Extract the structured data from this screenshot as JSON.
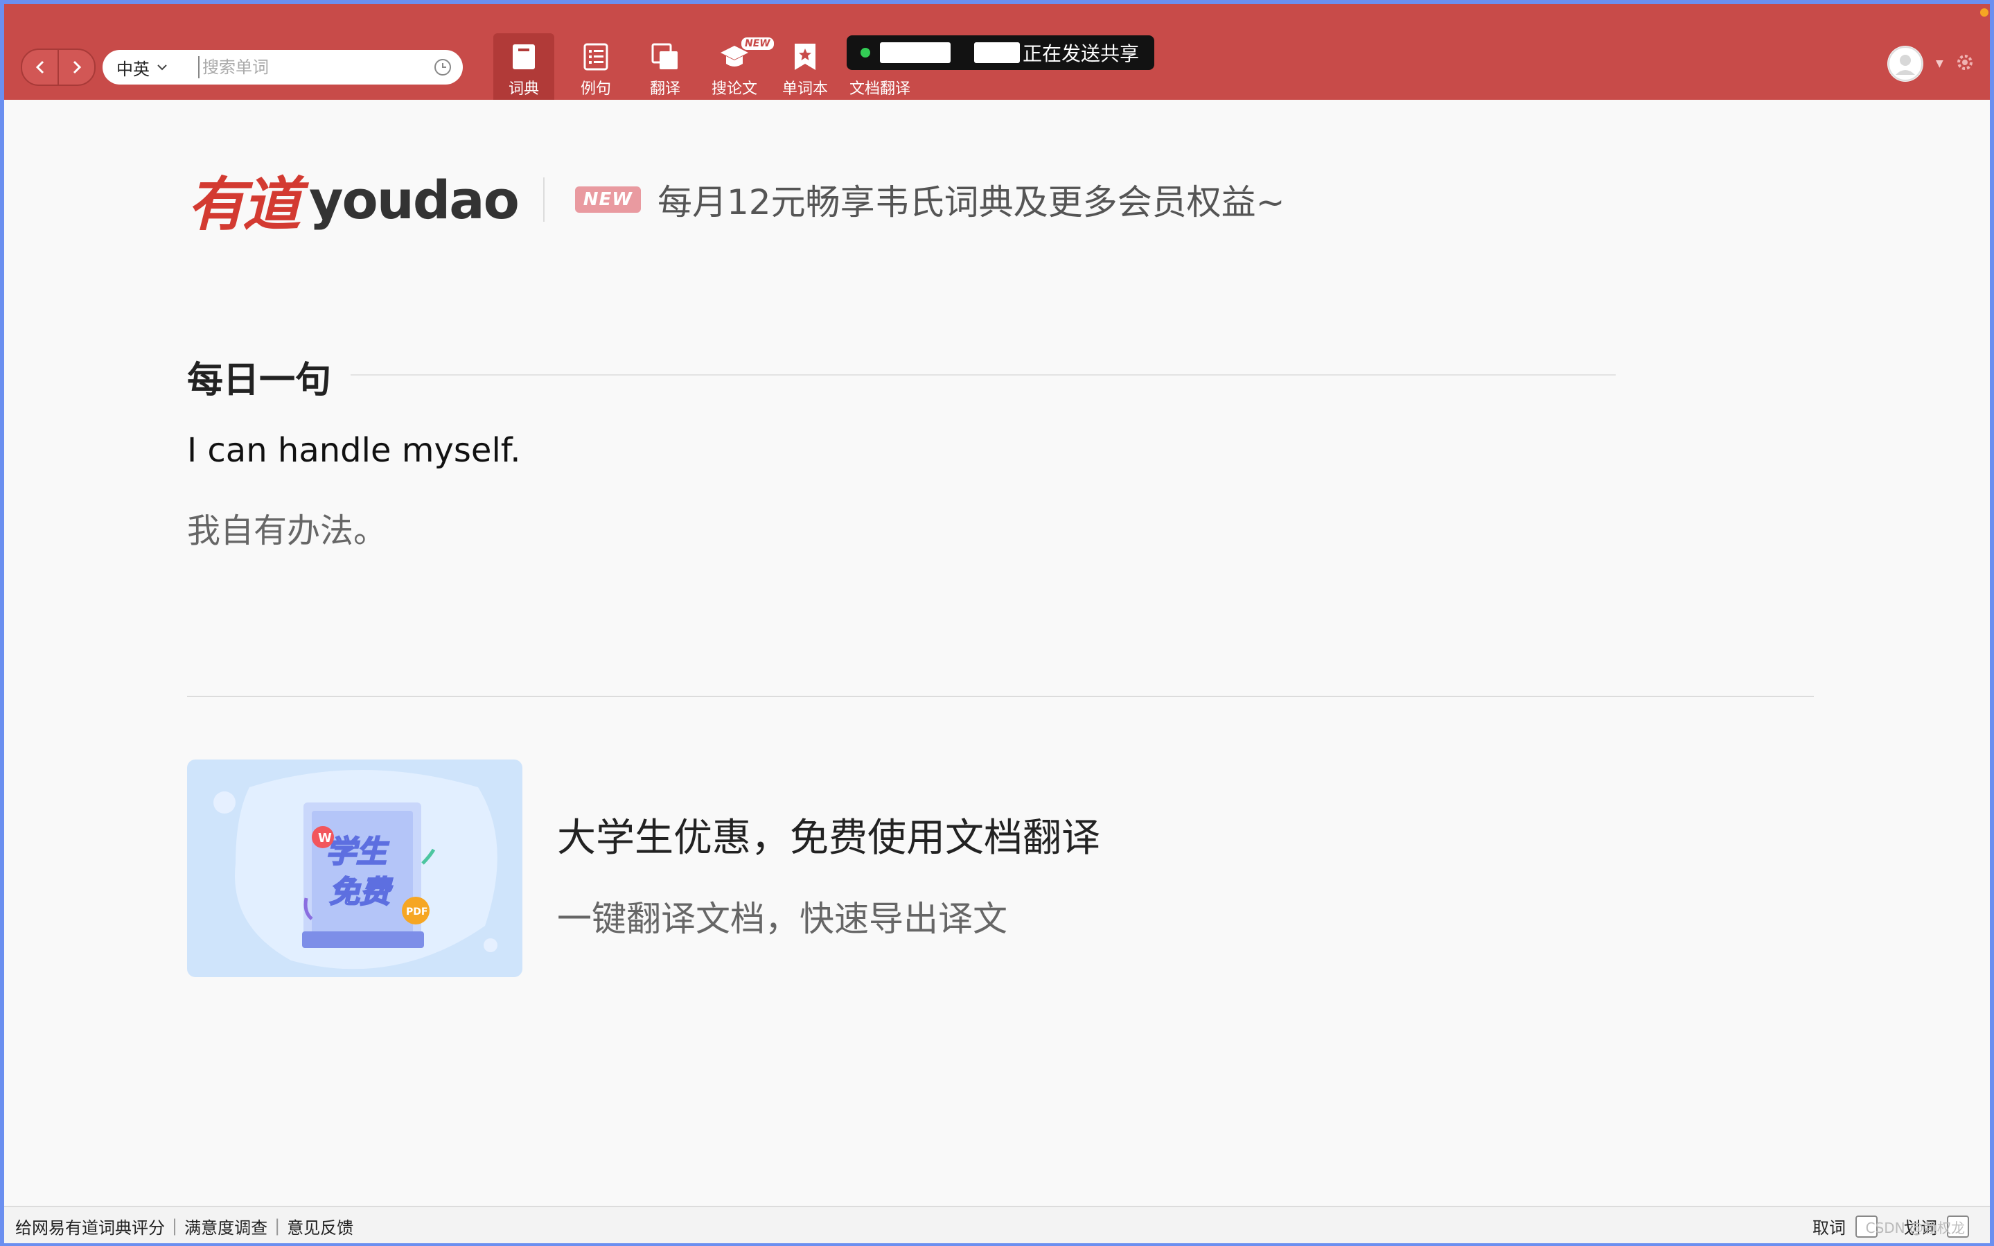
{
  "toolbar": {
    "lang_label": "中英",
    "search_placeholder": "搜索单词",
    "tools": [
      "词典",
      "例句",
      "翻译",
      "搜论文",
      "单词本",
      "文档翻译"
    ],
    "new_tag": "NEW",
    "share_status": "正在发送共享"
  },
  "banner": {
    "logo_cn": "有道",
    "logo_en": "youdao",
    "new_badge": "NEW",
    "promo_text": "每月12元畅享韦氏词典及更多会员权益~"
  },
  "daily": {
    "title": "每日一句",
    "sentence_en": "I can handle myself.",
    "sentence_cn": "我自有办法。"
  },
  "promo_card": {
    "image_text_line1": "学生",
    "image_text_line2": "免费",
    "image_badge_w": "W",
    "image_badge_pdf": "PDF",
    "title": "大学生优惠，免费使用文档翻译",
    "subtitle": "一键翻译文档，快速导出译文"
  },
  "footer": {
    "links": [
      "给网易有道词典评分",
      "满意度调查",
      "意见反馈"
    ],
    "qu_ci": "取词",
    "hua_ci": "划词",
    "watermark": "CSDN @赖权龙"
  },
  "colors": {
    "toolbar": "#c84b49",
    "accent_red": "#d33a31"
  }
}
